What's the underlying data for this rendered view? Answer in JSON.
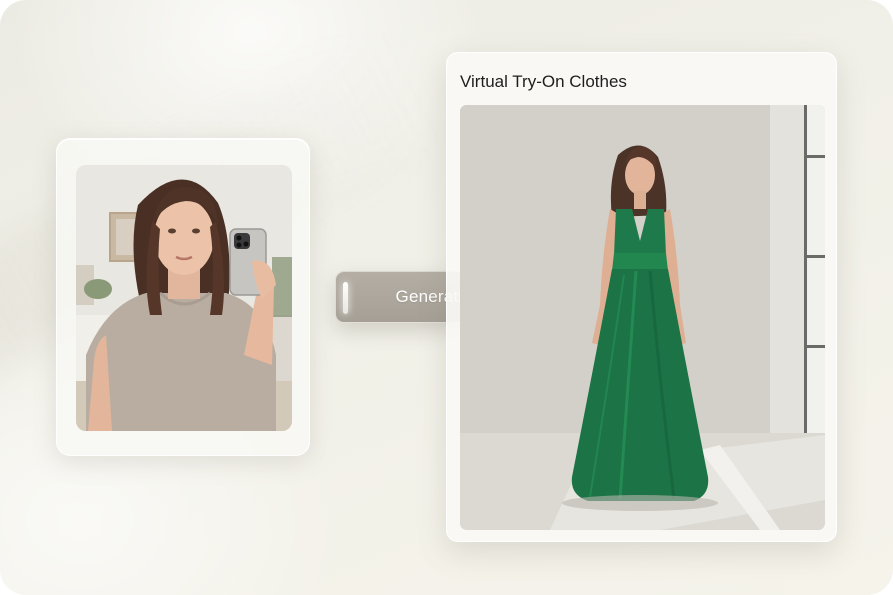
{
  "output_panel": {
    "title": "Virtual Try-On Clothes"
  },
  "status": {
    "label": "Generating..."
  },
  "images": {
    "input_photo": "selfie-photo",
    "output_photo": "green-dress-photo"
  },
  "colors": {
    "background": "#efede5",
    "pill": "#aca69c",
    "dress": "#1e7a4a",
    "title_text": "#1e1e1e"
  }
}
